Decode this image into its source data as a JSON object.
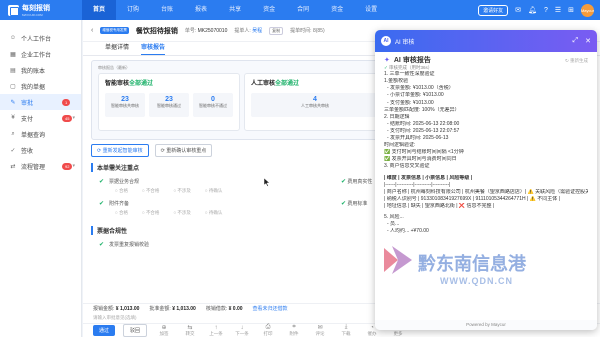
{
  "app": {
    "logo": "每刻报销",
    "logo_sub": "MAYCUR.COM"
  },
  "nav": [
    "首页",
    "订购",
    "台账",
    "报表",
    "共享",
    "资金",
    "合同",
    "资金",
    "设置"
  ],
  "top_right": {
    "invite": "邀请好友",
    "user": "Maycur"
  },
  "sidebar": [
    {
      "label": "个人工作台",
      "icon": "person-icon"
    },
    {
      "label": "企业工作台",
      "icon": "building-icon"
    },
    {
      "label": "我的账本",
      "icon": "ledger-icon"
    },
    {
      "label": "我的单据",
      "icon": "document-icon"
    },
    {
      "label": "审批",
      "icon": "approve-icon",
      "badge": "1",
      "active": true
    },
    {
      "label": "支付",
      "icon": "pay-icon",
      "badge": "45"
    },
    {
      "label": "单据查询",
      "icon": "search-icon"
    },
    {
      "label": "签收",
      "icon": "sign-icon"
    },
    {
      "label": "流程管理",
      "icon": "flow-icon",
      "badge": "92"
    }
  ],
  "header": {
    "tag": "增值税专用发票",
    "title": "餐饮招待报销",
    "doc_no_label": "单号:",
    "doc_no": "MK25070010",
    "submitter_label": "提单人:",
    "submitter": "吴程",
    "submit_time": "提单时间: 8(85)",
    "copy_btn": "复制"
  },
  "tabs": [
    "单据详情",
    "审核报告"
  ],
  "report": {
    "label": "审核报告（最新）",
    "smart_head": "智能审核",
    "smart_status": "全部通过",
    "manual_head": "人工审核",
    "manual_status": "全部通过",
    "smart_stats": [
      {
        "num": "23",
        "lbl": "智能审核共审核"
      },
      {
        "num": "23",
        "lbl": "智能审核通过"
      },
      {
        "num": "0",
        "lbl": "智能审核不通过"
      }
    ],
    "manual_stats": [
      {
        "num": "4",
        "lbl": "人工审核共审核"
      }
    ]
  },
  "actions": {
    "rerun": "重新发起智能审核",
    "confirm": "重新确认审核重点"
  },
  "focus": {
    "title": "本单需关注重点",
    "items": [
      {
        "label": "票据业务合规",
        "options": [
          "合格",
          "不合格",
          "不涉及",
          "待确认"
        ]
      },
      {
        "label": "附件齐备",
        "options": [
          "合格",
          "不合格",
          "不涉及",
          "待确认"
        ]
      }
    ],
    "right_items": [
      "费用真实性",
      "费用标准"
    ]
  },
  "compliance": {
    "title": "票据合规性",
    "item": "发票重复报销校验"
  },
  "totals": {
    "amount_label": "报销金额:",
    "amount": "¥ 1,013.00",
    "approved_label": "批准金额:",
    "approved": "¥ 1,013.00",
    "writeoff_label": "核销借款:",
    "writeoff": "¥ 0.00",
    "link": "查看未归还借款"
  },
  "approve_placeholder": "请输入审批意见(选填)",
  "footer": {
    "pass": "通过",
    "reject": "驳回",
    "tools": [
      "加签",
      "转交",
      "上一条",
      "下一条",
      "打印",
      "附件",
      "评论",
      "下载",
      "催办",
      "更多"
    ]
  },
  "ai": {
    "panel_title": "AI 审核",
    "report_title": "AI 审核报告",
    "regen": "重新生成",
    "done": "审核完成（用时36s）",
    "lines": [
      {
        "t": "1. 三单一致性深度验证",
        "cls": ""
      },
      {
        "t": "1.金额校验",
        "cls": ""
      },
      {
        "t": "- 发票金额: ¥1013.00（含税）",
        "cls": "ind"
      },
      {
        "t": "- 小票订单金额: ¥1013.00",
        "cls": "ind"
      },
      {
        "t": "- 支付金额: ¥1013.00",
        "cls": "ind"
      },
      {
        "t": "三单金额匹配度: 100%（无差异）",
        "cls": ""
      },
      {
        "t": "2. 日期逻辑",
        "cls": ""
      },
      {
        "t": "- 结账时间: 2025-06-13 22:08:00",
        "cls": "ind"
      },
      {
        "t": "- 支付时间: 2025-06-13 22:07:57",
        "cls": "ind"
      },
      {
        "t": "- 发票开具时间: 2025-06-13",
        "cls": "ind"
      },
      {
        "t": "时间逻辑验证:",
        "cls": ""
      },
      {
        "t": "✅ 支付时间与结账时间间隔 <1分钟",
        "cls": ""
      },
      {
        "t": "✅ 发票开具时间与消费时间同日",
        "cls": ""
      },
      {
        "t": "3. 商户信息交叉验证",
        "cls": ""
      },
      {
        "t": "",
        "cls": ""
      },
      {
        "t": "| 维度 | 发票信息 | 小票信息 | 风险等级 |",
        "cls": "bold"
      },
      {
        "t": "|------|----------|----------|----------|",
        "cls": ""
      },
      {
        "t": "| 商户名称 | 杭州每刻科技有限公司 | 杭州美餐（望京西路店店）| ⚠️ 关联风险（需验证控股关系）|",
        "cls": ""
      },
      {
        "t": "| 纳税人识别号 | 91330108341927699X | 91110105344264771H | ⚠️ 不同主体 |",
        "cls": ""
      },
      {
        "t": "| 地址信息 | 缺失 | 望京西路北街 | ❌ 信息不完整 |",
        "cls": ""
      },
      {
        "t": "",
        "cls": ""
      },
      {
        "t": "5. 风险...",
        "cls": ""
      },
      {
        "t": "- 员...",
        "cls": "ind"
      },
      {
        "t": "- 人均约... +¥70.00",
        "cls": "ind"
      }
    ],
    "footer": "Powered by Maycur"
  },
  "watermark": {
    "text": "黔东南信息港",
    "url": "WWW.QDN.CN"
  },
  "colors": {
    "primary": "#2b7cf0",
    "success": "#1db26a",
    "danger": "#f04b4b"
  }
}
